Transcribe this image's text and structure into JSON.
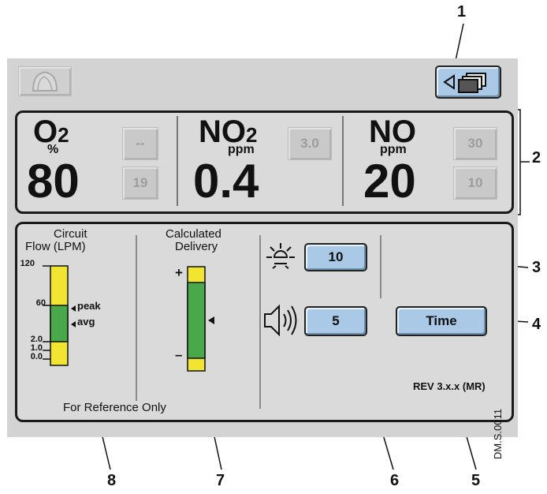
{
  "callouts": [
    "1",
    "2",
    "3",
    "4",
    "5",
    "6",
    "7",
    "8"
  ],
  "gases": [
    {
      "symbol": "O",
      "sub": "2",
      "unit": "%",
      "value": "80",
      "upper_alarm": "--",
      "lower_alarm": "19"
    },
    {
      "symbol": "NO",
      "sub": "2",
      "unit": "ppm",
      "value": "0.4",
      "upper_alarm": "3.0"
    },
    {
      "symbol": "NO",
      "sub": "",
      "unit": "ppm",
      "value": "20",
      "upper_alarm": "30",
      "lower_alarm": "10"
    }
  ],
  "flow": {
    "title_line1": "Circuit",
    "title_line2": "Flow (LPM)",
    "scale": [
      "120",
      "60",
      "2.0",
      "1.0",
      "0.0"
    ],
    "peak_label": "peak",
    "avg_label": "avg"
  },
  "delivery": {
    "title_line1": "Calculated",
    "title_line2": "Delivery",
    "plus": "+",
    "minus": "–"
  },
  "reference_note": "For Reference Only",
  "brightness_value": "10",
  "volume_value": "5",
  "time_button": "Time",
  "revision": "REV 3.x.x (MR)",
  "doc_code": "DM.S.0011",
  "colors": {
    "button": "#a9c9e6",
    "bar_yellow": "#f2e531",
    "bar_green": "#49a84a",
    "screen": "#d3d3d3"
  },
  "icons": [
    "alarm-bell-icon",
    "screen-switch-icon",
    "brightness-icon",
    "speaker-icon",
    "peak-marker-icon",
    "avg-marker-icon",
    "delivery-marker-icon"
  ]
}
